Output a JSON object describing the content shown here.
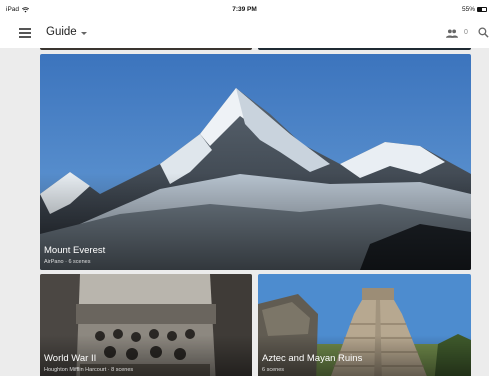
{
  "status_bar": {
    "device": "iPad",
    "time": "7:39 PM",
    "battery": "55%"
  },
  "app_bar": {
    "title": "Guide",
    "shared_count": "0"
  },
  "icons": {
    "menu": "hamburger-menu-icon",
    "dropdown": "caret-down-icon",
    "people": "people-icon",
    "search": "search-icon",
    "wifi": "wifi-icon",
    "battery": "battery-icon"
  },
  "cards": [
    {
      "title": "Mount Everest",
      "subtitle": "AirPano · 6 scenes"
    },
    {
      "title": "World War II",
      "subtitle": "Houghton Mifflin Harcourt · 8 scenes"
    },
    {
      "title": "Aztec and Mayan Ruins",
      "subtitle": "6 scenes"
    }
  ],
  "colors": {
    "background": "#ececec",
    "appbar": "#ffffff",
    "sky": "#3f7dc4"
  }
}
